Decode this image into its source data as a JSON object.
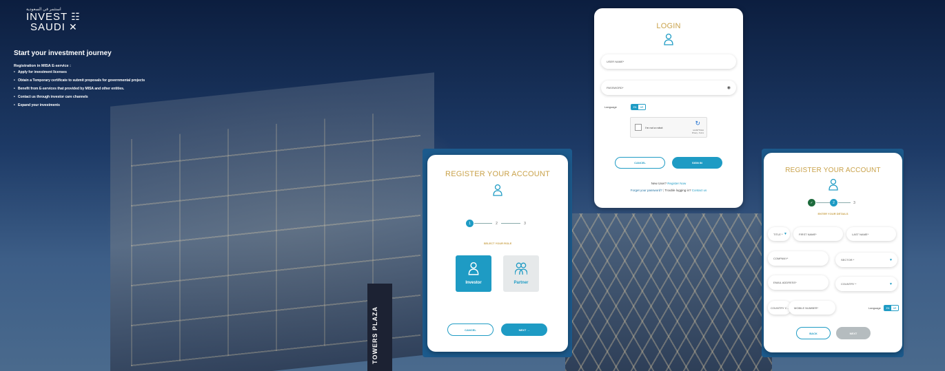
{
  "brand": {
    "arabic_small": "استثمر في السعودية",
    "name_line1": "INVEST",
    "name_line2": "SAUDI"
  },
  "intro": {
    "title": "Start your investment journey",
    "subtitle": "Registration in MISA E-service :",
    "items": [
      "Apply for investment licenses",
      "Obtain a Temporary certificate to submit proposals for governmental projects",
      "Benefit from E-services that provided by MISA and other entities.",
      "Contact us through investor care channels",
      "Expand your investments"
    ]
  },
  "background": {
    "sign_text": "TOWERS PLAZA"
  },
  "login": {
    "title": "LOGIN",
    "username_placeholder": "USER NAME*",
    "password_placeholder": "PASSWORD*",
    "language_label": "Language",
    "lang_en": "EN",
    "lang_ar": "AR",
    "captcha_label": "I'm not a robot",
    "captcha_brand": "reCAPTCHA",
    "captcha_terms": "Privacy - Terms",
    "cancel": "CANCEL",
    "sign_in": "SIGN IN",
    "new_user": "New User?",
    "register_now": "Register Now",
    "forgot_password": "Forget your password?",
    "trouble": "Trouble logging in?",
    "contact_us": "Contact us"
  },
  "register1": {
    "title": "REGISTER YOUR ACCOUNT",
    "steps": [
      "1",
      "2",
      "3"
    ],
    "select_role": "SELECT YOUR ROLE",
    "role_investor": "Investor",
    "role_partner": "Partner",
    "cancel": "CANCEL",
    "next": "NEXT →"
  },
  "register2": {
    "title": "REGISTER YOUR ACCOUNT",
    "steps": [
      "✓",
      "2",
      "3"
    ],
    "enter_details": "ENTER YOUR DETAILS",
    "title_field": "TITLE *",
    "first_name": "FIRST NAME*",
    "last_name": "LAST NAME*",
    "company": "COMPANY*",
    "sector": "SECTOR *",
    "email": "EMAIL ADDRESS*",
    "country": "COUNTRY *",
    "country_code": "COUNTRY C...",
    "mobile": "MOBILE NUMBER*",
    "language_label": "Language",
    "lang_en": "EN",
    "lang_ar": "AR",
    "back": "BACK",
    "next": "NEXT"
  },
  "colors": {
    "accent": "#1e9bc4",
    "gold": "#c9a24a",
    "card_frame": "#1c5a8c"
  }
}
